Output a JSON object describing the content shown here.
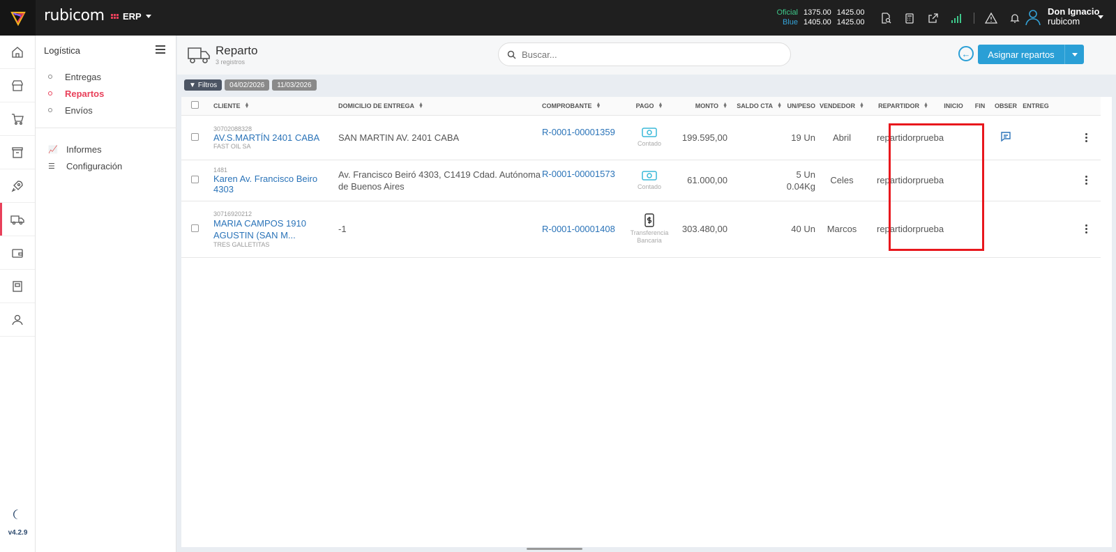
{
  "topbar": {
    "brand": "rubicom",
    "module": "ERP",
    "rates": [
      {
        "label": "Oficial",
        "buy": "1375.00",
        "sell": "1425.00",
        "color": "#3ec88a"
      },
      {
        "label": "Blue",
        "buy": "1405.00",
        "sell": "1425.00",
        "color": "#34a3d8"
      }
    ],
    "icons": [
      "document-search-icon",
      "calculator-icon",
      "external-link-icon",
      "signal-icon",
      "warning-icon",
      "bell-icon"
    ],
    "user": {
      "name": "Don Ignacio",
      "org": "rubicom"
    }
  },
  "rail": {
    "items": [
      "home-icon",
      "store-icon",
      "cart-icon",
      "box-icon",
      "rocket-icon",
      "truck-icon",
      "wallet-icon",
      "book-icon",
      "user-icon"
    ],
    "version": "v4.2.9"
  },
  "nav": {
    "title": "Logística",
    "items": [
      {
        "label": "Entregas"
      },
      {
        "label": "Repartos"
      },
      {
        "label": "Envíos"
      }
    ],
    "items2": [
      {
        "label": "Informes"
      },
      {
        "label": "Configuración"
      }
    ]
  },
  "page": {
    "title": "Reparto",
    "subtitle": "3 registros",
    "search_placeholder": "Buscar...",
    "assign_label": "Asignar repartos"
  },
  "filters": {
    "label": "Filtros",
    "from": "04/02/2026",
    "to": "11/03/2026"
  },
  "table": {
    "headers": {
      "cliente": "CLIENTE",
      "domicilio": "DOMICILIO DE ENTREGA",
      "comprobante": "COMPROBANTE",
      "pago": "PAGO",
      "monto": "MONTO",
      "saldo": "SALDO CTA",
      "unpeso": "UN/PESO",
      "vendedor": "VENDEDOR",
      "repartidor": "REPARTIDOR",
      "inicio": "INICIO",
      "fin": "FIN",
      "obser": "OBSER",
      "entreg": "ENTREG"
    },
    "rows": [
      {
        "code": "30702088328",
        "client": "AV.S.MARTÍN 2401 CABA",
        "client_sub": "FAST OIL SA",
        "address": "SAN MARTIN AV. 2401 CABA",
        "voucher": "R-0001-00001359",
        "payment": "Contado",
        "amount": "199.595,00",
        "units": "19 Un",
        "weight": "",
        "seller": "Abril",
        "courier": "repartidorprueba",
        "has_note": true
      },
      {
        "code": "1481",
        "client": "Karen Av. Francisco Beiro 4303",
        "client_sub": "",
        "address": "Av. Francisco Beiró 4303, C1419 Cdad. Autónoma de Buenos Aires",
        "voucher": "R-0001-00001573",
        "payment": "Contado",
        "amount": "61.000,00",
        "units": "5 Un",
        "weight": "0.04Kg",
        "seller": "Celes",
        "courier": "repartidorprueba",
        "has_note": false
      },
      {
        "code": "30716920212",
        "client": "MARIA CAMPOS 1910 AGUSTIN (SAN M...",
        "client_sub": "TRES GALLETITAS",
        "address": "-1",
        "voucher": "R-0001-00001408",
        "payment": "Transferencia Bancaria",
        "amount": "303.480,00",
        "units": "40 Un",
        "weight": "",
        "seller": "Marcos",
        "courier": "repartidorprueba",
        "has_note": false
      }
    ]
  }
}
